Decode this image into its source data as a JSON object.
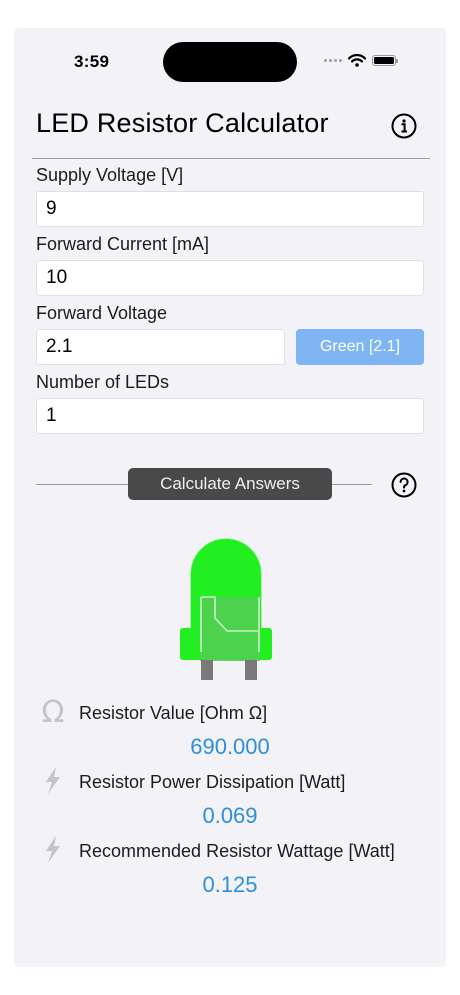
{
  "status_bar": {
    "time": "3:59",
    "wifi_icon": "wifi-icon",
    "battery_icon": "battery-icon"
  },
  "header": {
    "title": "LED Resistor Calculator",
    "info_icon": "info-icon"
  },
  "inputs": {
    "supply_voltage": {
      "label": "Supply Voltage [V]",
      "value": "9"
    },
    "forward_current": {
      "label": "Forward Current [mA]",
      "value": "10"
    },
    "forward_voltage": {
      "label": "Forward Voltage",
      "value": "2.1",
      "color_button": "Green [2.1]"
    },
    "num_leds": {
      "label": "Number of LEDs",
      "value": "1"
    }
  },
  "actions": {
    "calculate_label": "Calculate Answers",
    "help_icon": "question-icon"
  },
  "led": {
    "color": "#22ee22",
    "icon": "led-icon"
  },
  "results": [
    {
      "icon": "omega-icon",
      "label": "Resistor Value [Ohm Ω]",
      "value": "690.000"
    },
    {
      "icon": "lightning-icon",
      "label": "Resistor Power Dissipation [Watt]",
      "value": "0.069"
    },
    {
      "icon": "lightning-icon",
      "label": "Recommended Resistor Wattage [Watt]",
      "value": "0.125"
    }
  ],
  "colors": {
    "accent": "#2f8fd8",
    "color_button_bg": "#7fb5f3",
    "calc_button_bg": "#494949",
    "background": "#f2f2f7"
  }
}
